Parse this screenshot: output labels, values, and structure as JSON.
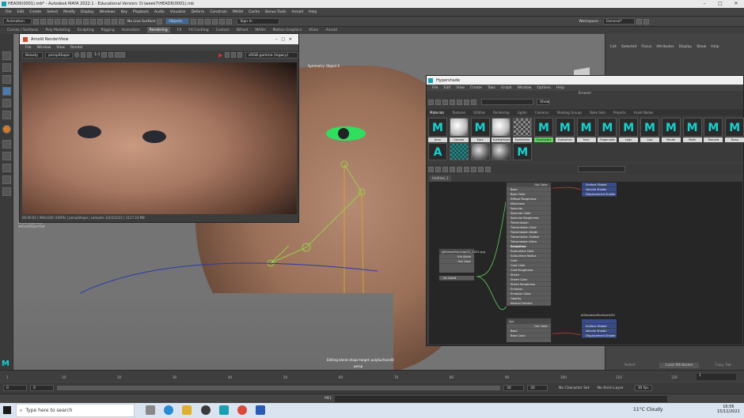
{
  "window": {
    "title": "HEAD6(0001).mb* - Autodesk MAYA 2022.1 - Educational Version: D:\\week7\\HEAD6(0001).mb"
  },
  "menubar": [
    "File",
    "Edit",
    "Create",
    "Select",
    "Modify",
    "Display",
    "Windows",
    "Key",
    "Playback",
    "Audio",
    "Visualize",
    "Deform",
    "Constrain",
    "MASH",
    "Cache",
    "Bonus Tools",
    "Arnold",
    "Help"
  ],
  "status": {
    "mode": "Animation",
    "live": "No Live Surface",
    "objects": "Objects",
    "signin": "Sign In",
    "workspace": "Workspace :",
    "workspace_value": "General*"
  },
  "shelf_tabs": [
    "Curves / Surfaces",
    "Poly Modeling",
    "Sculpting",
    "Rigging",
    "Animation",
    "Rendering",
    "FX",
    "FX Caching",
    "Custom",
    "Bifrost",
    "MASH",
    "Motion Graphics",
    "XGen",
    "Arnold"
  ],
  "shelf_active": "Rendering",
  "right_panel": {
    "menu": [
      "List",
      "Selected",
      "Focus",
      "Attributes",
      "Display",
      "Show",
      "Help"
    ],
    "footer": [
      "Select",
      "Load Attributes",
      "Copy Tab"
    ]
  },
  "viewport": {
    "symmetry": "Symmetry: Object X",
    "editing": "Editing blend shape target: polySurface40",
    "camera": "persp"
  },
  "renderview": {
    "title": "Arnold RenderView",
    "menu": [
      "File",
      "Window",
      "View",
      "Render"
    ],
    "beauty": "Beauty",
    "camera": "perspShape",
    "ratio": "1:1",
    "colorspace": "sRGB gamma (legacy)",
    "status": "00:00:02 | 960x540 (100%) | perspShape | samples 3/2/2/2/2/2 | 1117.33 MB",
    "outliner": [
      "defaultLightSet",
      "defaultObjectSet"
    ]
  },
  "hypershade": {
    "title": "Hypershade",
    "menu": [
      "File",
      "Edit",
      "View",
      "Create",
      "Tabs",
      "Graph",
      "Window",
      "Options",
      "Help"
    ],
    "browser_label": "Browser",
    "show_btn": "Show",
    "tabs": [
      "Materials",
      "Textures",
      "Utilities",
      "Rendering",
      "Lights",
      "Cameras",
      "Shading Groups",
      "Bake Sets",
      "Projects",
      "Asset Nodes"
    ],
    "row1": [
      "Arnn",
      "Cornea",
      "Ears",
      "Eyehighlight",
      "Eyeinterior",
      "EyeSocket",
      "Eyelashes",
      "Face",
      "Fingernails",
      "Legs",
      "Lips",
      "Mouth",
      "Teeth",
      "Toenails",
      "Torso"
    ],
    "row1_selected": "EyeSocket",
    "graph_tab": "Untitled_1",
    "file_node": "gBrowseSecmap01_1001.jpg",
    "file_node_attrs": [
      "Out Alpha",
      "Out Color"
    ],
    "file_node_uv": "Uv Coord",
    "main_attrs": [
      "Out Color",
      "Base",
      "Base Color",
      "Diffuse Roughness",
      "Metalness",
      "Specular",
      "Specular Color",
      "Specular Roughness",
      "Transmission",
      "Transmission Color",
      "Transmission Depth",
      "Transmission Scatter",
      "Transmission Extra Roughness",
      "Subsurface",
      "Subsurface Color",
      "Subsurface Radius",
      "Coat",
      "Coat Color",
      "Coat Roughness",
      "Sheen",
      "Sheen Color",
      "Sheen Roughness",
      "Emission",
      "Emission Color",
      "Opacity",
      "Normal Camera"
    ],
    "sg1": [
      "Surface Shader",
      "Volume Shader",
      "Displacement Shader"
    ],
    "lips_node": "lips",
    "lips_attrs": [
      "Out Color",
      "Base",
      "Base Color"
    ],
    "sg2_name": "aiStandardSurface4SG",
    "sg2": [
      "Surface Shader",
      "Volume Shader",
      "Displacement Shader"
    ]
  },
  "timeslider": {
    "ticks": [
      "1",
      "10",
      "20",
      "30",
      "40",
      "50",
      "60",
      "70",
      "80",
      "90",
      "100",
      "110",
      "120"
    ],
    "current": "1"
  },
  "range": {
    "start": "0",
    "start2": "0",
    "end1": "30",
    "end2": "30",
    "no_char": "No Character Set",
    "no_anim": "No Anim Layer",
    "fps": "30 fps"
  },
  "cmdline": {
    "label": "MEL"
  },
  "taskbar": {
    "search": "Type here to search",
    "weather": "11°C  Cloudy",
    "time": "16:56",
    "date": "15/11/2021"
  },
  "colors": {
    "maya_cyan": "#18d0d0",
    "selected_green": "#5fd15f",
    "sg_blue": "#3a4a8a"
  }
}
